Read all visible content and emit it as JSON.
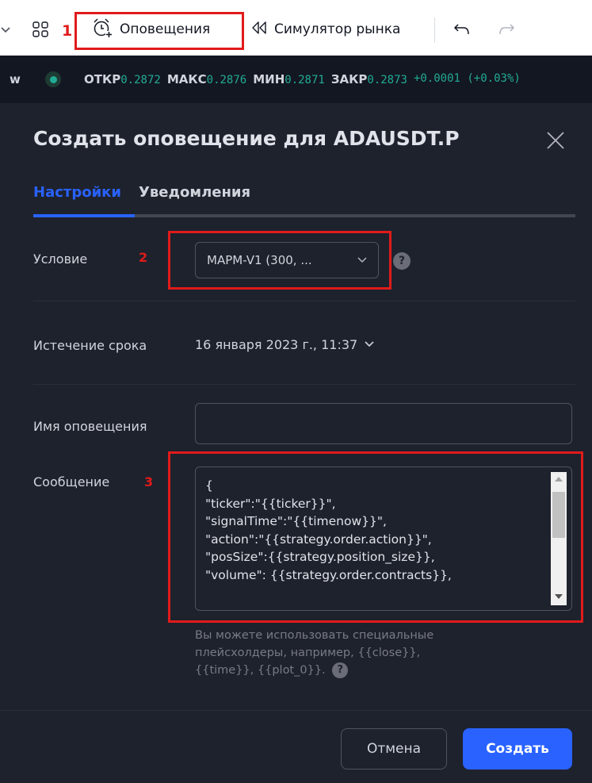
{
  "toolbar": {
    "alerts_label": "Оповещения",
    "sim_label": "Симулятор рынка",
    "annotation_1": "1"
  },
  "ohlc": {
    "ticker_tail": "w",
    "open_label": "ОТКР",
    "open": "0.2872",
    "high_label": "МАКС",
    "high": "0.2876",
    "low_label": "МИН",
    "low": "0.2871",
    "close_label": "ЗАКР",
    "close": "0.2873",
    "change": "+0.0001 (+0.03%)"
  },
  "dialog": {
    "title": "Создать оповещение для ADAUSDT.P",
    "tabs": [
      {
        "label": "Настройки",
        "active": true
      },
      {
        "label": "Уведомления",
        "active": false
      }
    ],
    "condition": {
      "label": "Условие",
      "annotation": "2",
      "value": "MAPM-V1 (300, ..."
    },
    "expiry": {
      "label": "Истечение срока",
      "value": "16 января 2023 г., 11:37"
    },
    "alert_name": {
      "label": "Имя оповещения",
      "value": ""
    },
    "message": {
      "label": "Сообщение",
      "annotation": "3",
      "lines": [
        "{",
        "\"ticker\":\"{{ticker}}\",",
        "\"signalTime\":\"{{timenow}}\",",
        "\"action\":\"{{strategy.order.action}}\",",
        "\"posSize\":{{strategy.position_size}},",
        "\"volume\": {{strategy.order.contracts}},"
      ],
      "hint": "Вы можете использовать специальные плейсхолдеры, например, {{close}}, {{time}}, {{plot_0}}."
    },
    "help_glyph": "?",
    "buttons": {
      "cancel": "Отмена",
      "create": "Создать"
    }
  },
  "colors": {
    "accent": "#2962ff",
    "positive": "#22ab94",
    "annotation": "#e01b1b",
    "panel": "#1e222d"
  }
}
